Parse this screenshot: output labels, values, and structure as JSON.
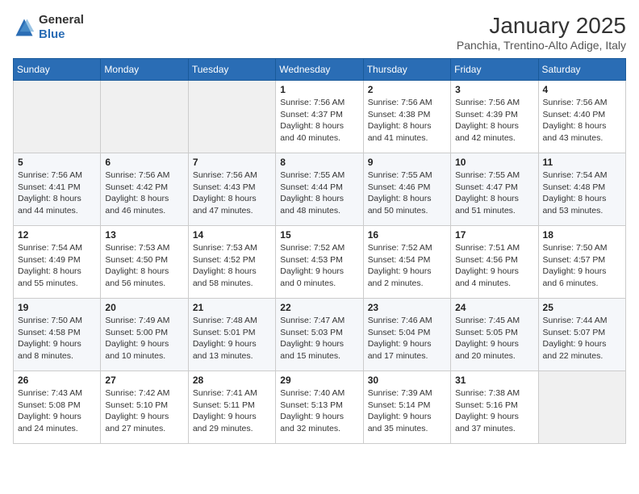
{
  "header": {
    "logo_line1": "General",
    "logo_line2": "Blue",
    "month_title": "January 2025",
    "location": "Panchia, Trentino-Alto Adige, Italy"
  },
  "weekdays": [
    "Sunday",
    "Monday",
    "Tuesday",
    "Wednesday",
    "Thursday",
    "Friday",
    "Saturday"
  ],
  "weeks": [
    [
      {
        "day": "",
        "info": ""
      },
      {
        "day": "",
        "info": ""
      },
      {
        "day": "",
        "info": ""
      },
      {
        "day": "1",
        "info": "Sunrise: 7:56 AM\nSunset: 4:37 PM\nDaylight: 8 hours\nand 40 minutes."
      },
      {
        "day": "2",
        "info": "Sunrise: 7:56 AM\nSunset: 4:38 PM\nDaylight: 8 hours\nand 41 minutes."
      },
      {
        "day": "3",
        "info": "Sunrise: 7:56 AM\nSunset: 4:39 PM\nDaylight: 8 hours\nand 42 minutes."
      },
      {
        "day": "4",
        "info": "Sunrise: 7:56 AM\nSunset: 4:40 PM\nDaylight: 8 hours\nand 43 minutes."
      }
    ],
    [
      {
        "day": "5",
        "info": "Sunrise: 7:56 AM\nSunset: 4:41 PM\nDaylight: 8 hours\nand 44 minutes."
      },
      {
        "day": "6",
        "info": "Sunrise: 7:56 AM\nSunset: 4:42 PM\nDaylight: 8 hours\nand 46 minutes."
      },
      {
        "day": "7",
        "info": "Sunrise: 7:56 AM\nSunset: 4:43 PM\nDaylight: 8 hours\nand 47 minutes."
      },
      {
        "day": "8",
        "info": "Sunrise: 7:55 AM\nSunset: 4:44 PM\nDaylight: 8 hours\nand 48 minutes."
      },
      {
        "day": "9",
        "info": "Sunrise: 7:55 AM\nSunset: 4:46 PM\nDaylight: 8 hours\nand 50 minutes."
      },
      {
        "day": "10",
        "info": "Sunrise: 7:55 AM\nSunset: 4:47 PM\nDaylight: 8 hours\nand 51 minutes."
      },
      {
        "day": "11",
        "info": "Sunrise: 7:54 AM\nSunset: 4:48 PM\nDaylight: 8 hours\nand 53 minutes."
      }
    ],
    [
      {
        "day": "12",
        "info": "Sunrise: 7:54 AM\nSunset: 4:49 PM\nDaylight: 8 hours\nand 55 minutes."
      },
      {
        "day": "13",
        "info": "Sunrise: 7:53 AM\nSunset: 4:50 PM\nDaylight: 8 hours\nand 56 minutes."
      },
      {
        "day": "14",
        "info": "Sunrise: 7:53 AM\nSunset: 4:52 PM\nDaylight: 8 hours\nand 58 minutes."
      },
      {
        "day": "15",
        "info": "Sunrise: 7:52 AM\nSunset: 4:53 PM\nDaylight: 9 hours\nand 0 minutes."
      },
      {
        "day": "16",
        "info": "Sunrise: 7:52 AM\nSunset: 4:54 PM\nDaylight: 9 hours\nand 2 minutes."
      },
      {
        "day": "17",
        "info": "Sunrise: 7:51 AM\nSunset: 4:56 PM\nDaylight: 9 hours\nand 4 minutes."
      },
      {
        "day": "18",
        "info": "Sunrise: 7:50 AM\nSunset: 4:57 PM\nDaylight: 9 hours\nand 6 minutes."
      }
    ],
    [
      {
        "day": "19",
        "info": "Sunrise: 7:50 AM\nSunset: 4:58 PM\nDaylight: 9 hours\nand 8 minutes."
      },
      {
        "day": "20",
        "info": "Sunrise: 7:49 AM\nSunset: 5:00 PM\nDaylight: 9 hours\nand 10 minutes."
      },
      {
        "day": "21",
        "info": "Sunrise: 7:48 AM\nSunset: 5:01 PM\nDaylight: 9 hours\nand 13 minutes."
      },
      {
        "day": "22",
        "info": "Sunrise: 7:47 AM\nSunset: 5:03 PM\nDaylight: 9 hours\nand 15 minutes."
      },
      {
        "day": "23",
        "info": "Sunrise: 7:46 AM\nSunset: 5:04 PM\nDaylight: 9 hours\nand 17 minutes."
      },
      {
        "day": "24",
        "info": "Sunrise: 7:45 AM\nSunset: 5:05 PM\nDaylight: 9 hours\nand 20 minutes."
      },
      {
        "day": "25",
        "info": "Sunrise: 7:44 AM\nSunset: 5:07 PM\nDaylight: 9 hours\nand 22 minutes."
      }
    ],
    [
      {
        "day": "26",
        "info": "Sunrise: 7:43 AM\nSunset: 5:08 PM\nDaylight: 9 hours\nand 24 minutes."
      },
      {
        "day": "27",
        "info": "Sunrise: 7:42 AM\nSunset: 5:10 PM\nDaylight: 9 hours\nand 27 minutes."
      },
      {
        "day": "28",
        "info": "Sunrise: 7:41 AM\nSunset: 5:11 PM\nDaylight: 9 hours\nand 29 minutes."
      },
      {
        "day": "29",
        "info": "Sunrise: 7:40 AM\nSunset: 5:13 PM\nDaylight: 9 hours\nand 32 minutes."
      },
      {
        "day": "30",
        "info": "Sunrise: 7:39 AM\nSunset: 5:14 PM\nDaylight: 9 hours\nand 35 minutes."
      },
      {
        "day": "31",
        "info": "Sunrise: 7:38 AM\nSunset: 5:16 PM\nDaylight: 9 hours\nand 37 minutes."
      },
      {
        "day": "",
        "info": ""
      }
    ]
  ]
}
